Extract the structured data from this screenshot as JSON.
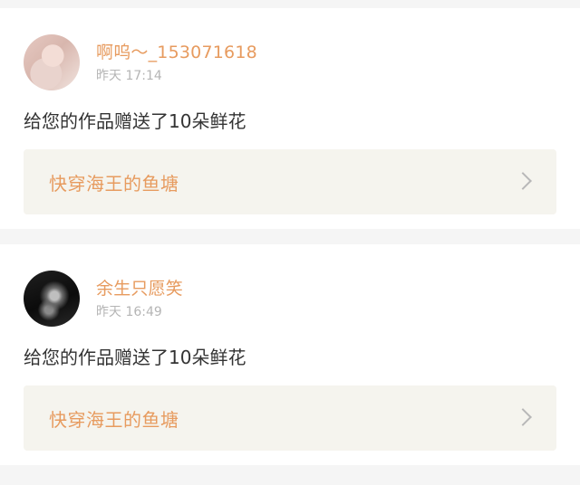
{
  "notifications": [
    {
      "username": "啊呜～_153071618",
      "time": "昨天 17:14",
      "message": "给您的作品赠送了10朵鲜花",
      "work_title": "快穿海王的鱼塘"
    },
    {
      "username": "余生只愿笑",
      "time": "昨天 16:49",
      "message": "给您的作品赠送了10朵鲜花",
      "work_title": "快穿海王的鱼塘"
    }
  ],
  "colors": {
    "accent": "#e79b5f",
    "time_gray": "#b5b5b5",
    "link_bg": "#f5f4ee",
    "page_bg": "#f5f5f5"
  },
  "icons": {
    "chevron": "chevron-right-icon"
  }
}
